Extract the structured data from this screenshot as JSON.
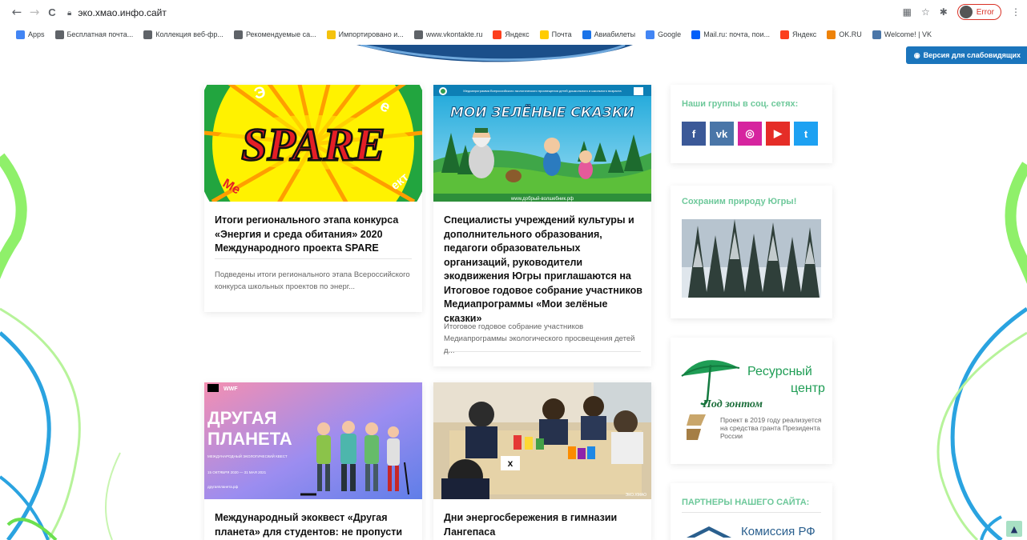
{
  "browser": {
    "back_icon": "←",
    "forward_icon": "→",
    "reload_icon": "C",
    "url": "эко.хмао.инфо.сайт",
    "error_label": "Error"
  },
  "bookmarks": [
    {
      "label": "Apps",
      "color": "#4285f4"
    },
    {
      "label": "Бесплатная почта...",
      "color": "#5f6368"
    },
    {
      "label": "Коллекция веб-фр...",
      "color": "#5f6368"
    },
    {
      "label": "Рекомендуемые са...",
      "color": "#5f6368"
    },
    {
      "label": "Импортировано и...",
      "color": "#f4c20d"
    },
    {
      "label": "www.vkontakte.ru",
      "color": "#5f6368"
    },
    {
      "label": "Яндекс",
      "color": "#fc3f1d"
    },
    {
      "label": "Почта",
      "color": "#ffcc00"
    },
    {
      "label": "Авиабилеты",
      "color": "#1a73e8"
    },
    {
      "label": "Google",
      "color": "#4285f4"
    },
    {
      "label": "Mail.ru: почта, пои...",
      "color": "#005ff9"
    },
    {
      "label": "Яндекс",
      "color": "#fc3f1d"
    },
    {
      "label": "OK.RU",
      "color": "#ee8208"
    },
    {
      "label": "Welcome! | VK",
      "color": "#4a76a8"
    }
  ],
  "accessibility_button": "Версия для слабовидящих",
  "cards": [
    {
      "image_text": "SPARE",
      "image_arc_top": "Энергия и среда обитания",
      "image_arc_bottom": "Международный проект",
      "title": "Итоги регионального этапа конкурса «Энергия и среда обитания» 2020 Международного проекта SPARE",
      "excerpt": "Подведены итоги регионального этапа Всероссийского конкурса школьных проектов по энерг..."
    },
    {
      "image_header": "Медиапрограмма Всероссийского экологического просвещения детей дошкольного и школьного возраста",
      "image_text": "МОИ ЗЕЛЁНЫЕ СКАЗКИ",
      "image_footer": "www.добрый-волшебник.рф",
      "title": "Специалисты учреждений культуры и дополнительного образования, педагоги образовательных организаций, руководители экодвижения Югры приглашаются на Итоговое годовое собрание участников Медиапрограммы «Мои зелёные сказки»",
      "excerpt": "Итоговое годовое собрание участников Медиапрограммы экологического просвещения детей д..."
    },
    {
      "image_logo": "WWF",
      "image_text": "ДРУГАЯ ПЛАНЕТА",
      "image_subtext": "МЕЖДУНАРОДНЫЙ ЭКОЛОГИЧЕСКИЙ КВЕСТ",
      "image_dates": "15 ОКТЯБРЯ 2020 — 31 МАЯ 2021",
      "image_url": "другаяпланета.рф",
      "title": "Международный экоквест «Другая планета» для студентов: не пропусти",
      "excerpt": ""
    },
    {
      "image_caption": "ЭКО.ХМАО",
      "title": "Дни энергосбережения в гимназии Лангепаса",
      "excerpt": ""
    }
  ],
  "sidebar": {
    "social_title": "Наши группы в соц. сетях:",
    "social": [
      {
        "name": "facebook",
        "glyph": "f",
        "color": "#3b5998"
      },
      {
        "name": "vk",
        "glyph": "vk",
        "color": "#4a76a8"
      },
      {
        "name": "instagram",
        "glyph": "◎",
        "color": "#d6249f"
      },
      {
        "name": "youtube",
        "glyph": "▶",
        "color": "#e52d27"
      },
      {
        "name": "twitter",
        "glyph": "t",
        "color": "#1da1f2"
      }
    ],
    "nature_title": "Сохраним природу Югры!",
    "resource_line1": "Ресурсный",
    "resource_line2": "центр",
    "resource_logo": "Под зонтом",
    "resource_note": "Проект в 2019 году реализуется на средства гранта Президента России",
    "partners_title": "ПАРТНЕРЫ НАШЕГО САЙТА:",
    "partner_name": "Комиссия РФ"
  }
}
